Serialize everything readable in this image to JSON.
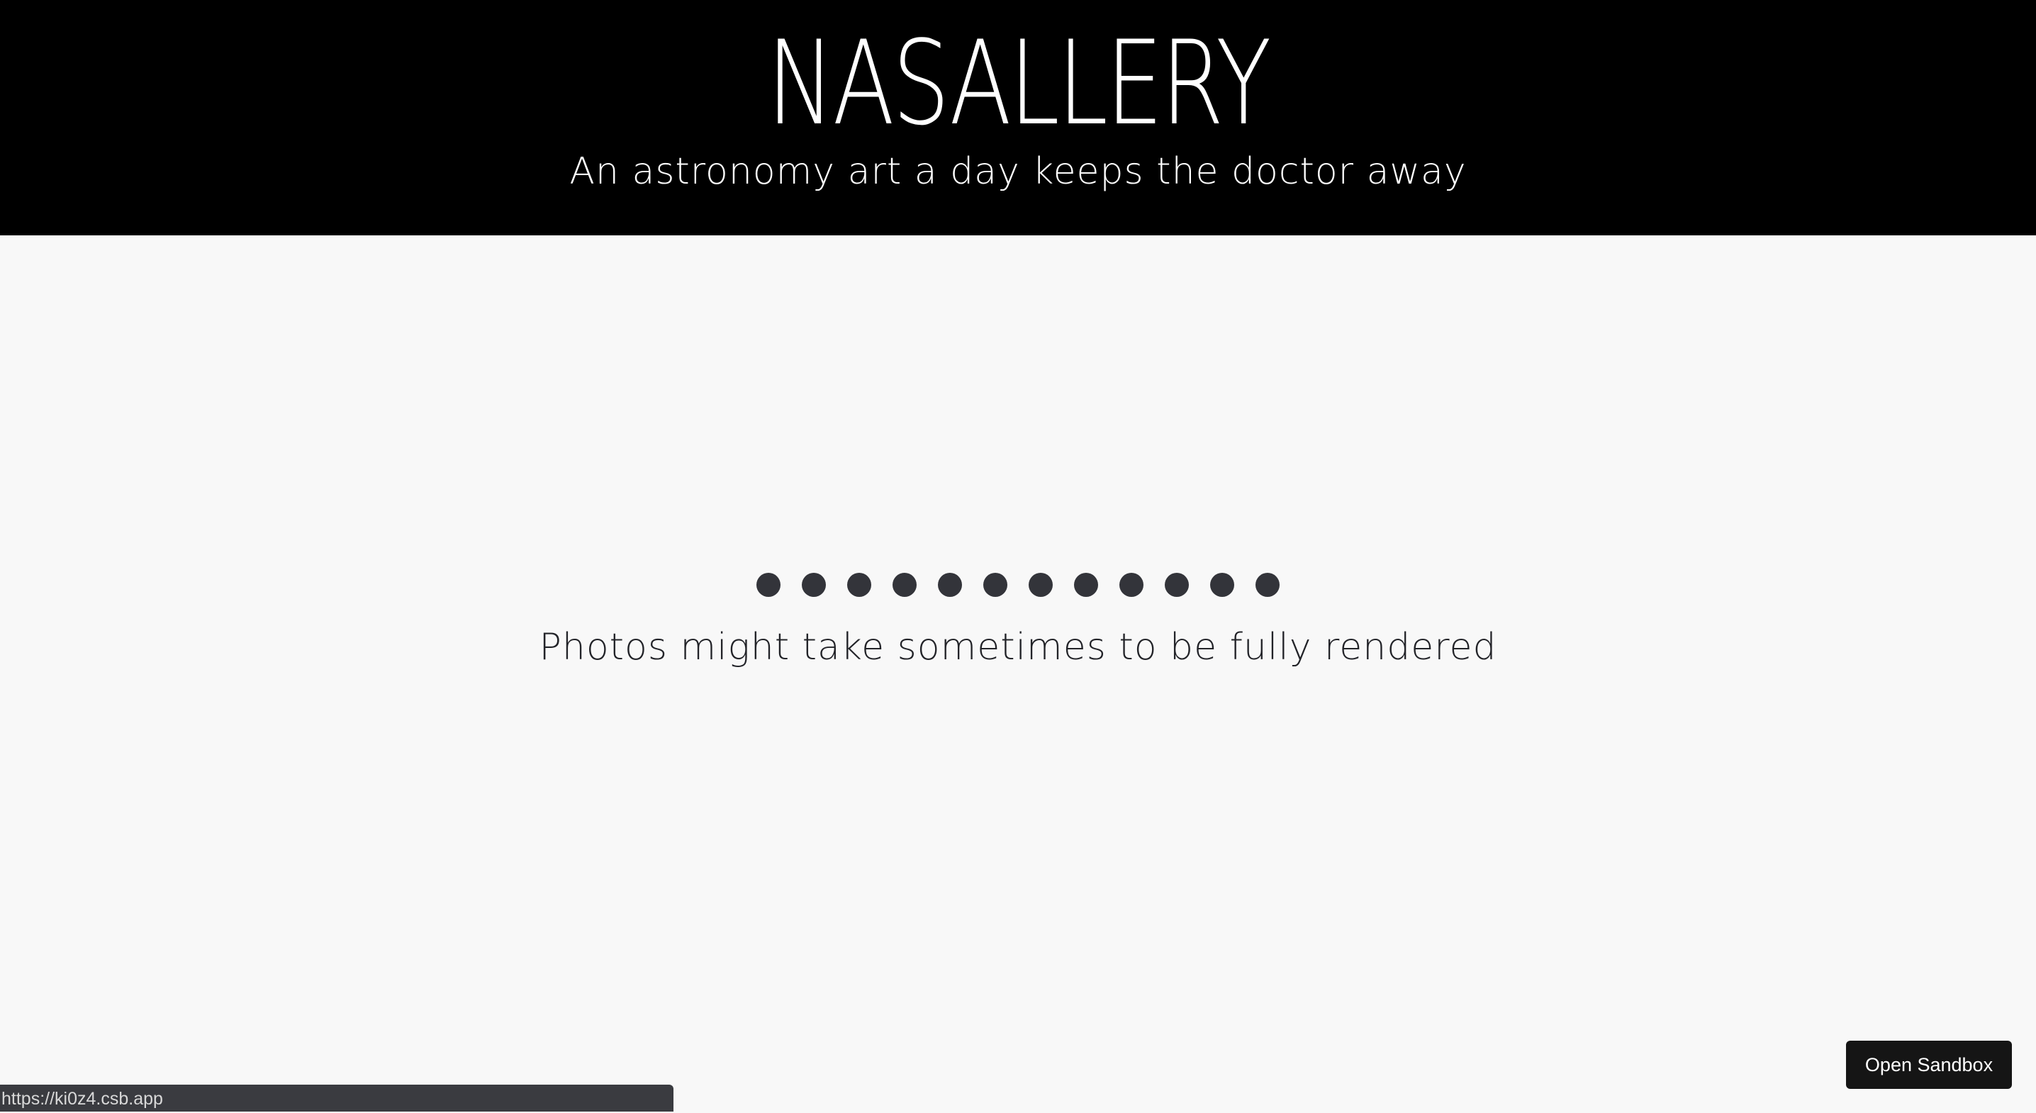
{
  "header": {
    "title": "NASALLERY",
    "subtitle": "An astronomy art a day keeps the doctor away"
  },
  "loader": {
    "dot_count": 12,
    "message": "Photos might take sometimes to be fully rendered"
  },
  "status_bar": {
    "url": "https://ki0z4.csb.app"
  },
  "sandbox_button": {
    "label": "Open Sandbox"
  },
  "colors": {
    "header_bg": "#000000",
    "page_bg": "#f8f8f8",
    "dot": "#33343a",
    "text": "#222328"
  }
}
